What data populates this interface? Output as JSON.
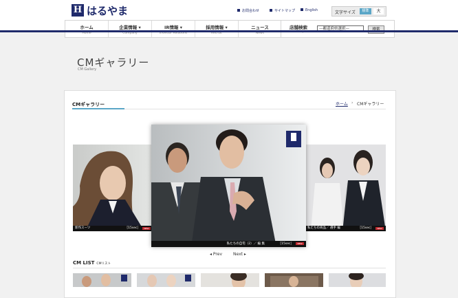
{
  "header": {
    "logo_mark": "H",
    "logo_text": "はるやま",
    "util_links": [
      "お問合わせ",
      "サイトマップ",
      "English"
    ],
    "font_size": {
      "label": "文字サイズ",
      "standard": "標準",
      "large": "大"
    }
  },
  "gnav": [
    {
      "jp": "ホーム",
      "en": "Home"
    },
    {
      "jp": "企業情報 ▾",
      "en": "Company"
    },
    {
      "jp": "IR情報 ▾",
      "en": "Investor Relations"
    },
    {
      "jp": "採用情報 ▾",
      "en": "Recruit"
    },
    {
      "jp": "ニュース",
      "en": "News"
    }
  ],
  "store": {
    "jp": "店舗検索",
    "en": "Shop",
    "select": "—都道府県選択—",
    "button": "検索"
  },
  "page": {
    "title": "CMギャラリー",
    "subtitle": "CM Gallery"
  },
  "section": {
    "title": "CMギャラリー"
  },
  "breadcrumb": {
    "home": "ホーム",
    "separator": "›",
    "current": "CMギャラリー"
  },
  "carousel": {
    "slides": [
      {
        "caption": "新作スーツ",
        "duration": "［15sec］",
        "badge": "NEW"
      },
      {
        "caption": "私たちの自宅（2）／ 編 集",
        "duration": "［15sec］",
        "badge": "NEW"
      },
      {
        "caption": "私たちの商品／ 選手 編",
        "duration": "［15sec］",
        "badge": "NEW"
      }
    ],
    "prev": "Prev",
    "next": "Next"
  },
  "cm_list": {
    "title": "CM LIST",
    "subtitle": "CMリスト"
  },
  "colors": {
    "brand": "#1f2a6b",
    "accent": "#5aa6c7",
    "badge": "#c1272d"
  }
}
